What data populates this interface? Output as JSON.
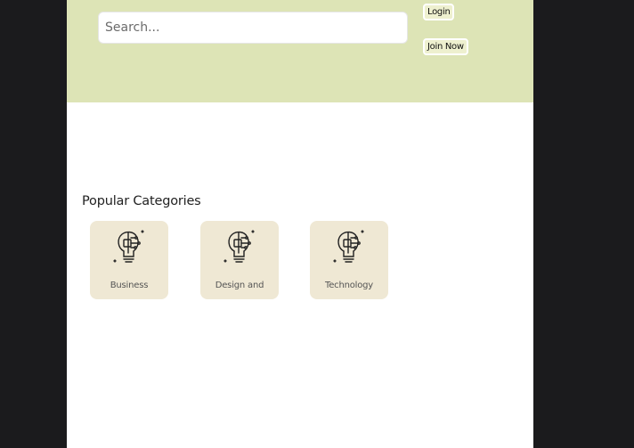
{
  "header": {
    "search_placeholder": "Search...",
    "login_label": "Login",
    "join_label": "Join Now"
  },
  "popular": {
    "title": "Popular Categories",
    "categories": [
      {
        "label": "Business",
        "icon": "lightbulb-circuit-icon"
      },
      {
        "label": "Design and",
        "icon": "lightbulb-circuit-icon"
      },
      {
        "label": "Technology",
        "icon": "lightbulb-circuit-icon"
      }
    ]
  },
  "colors": {
    "hero_bg": "#dde4b6",
    "card_bg": "#efe8d4",
    "outer_bg": "#1b1b1d"
  }
}
